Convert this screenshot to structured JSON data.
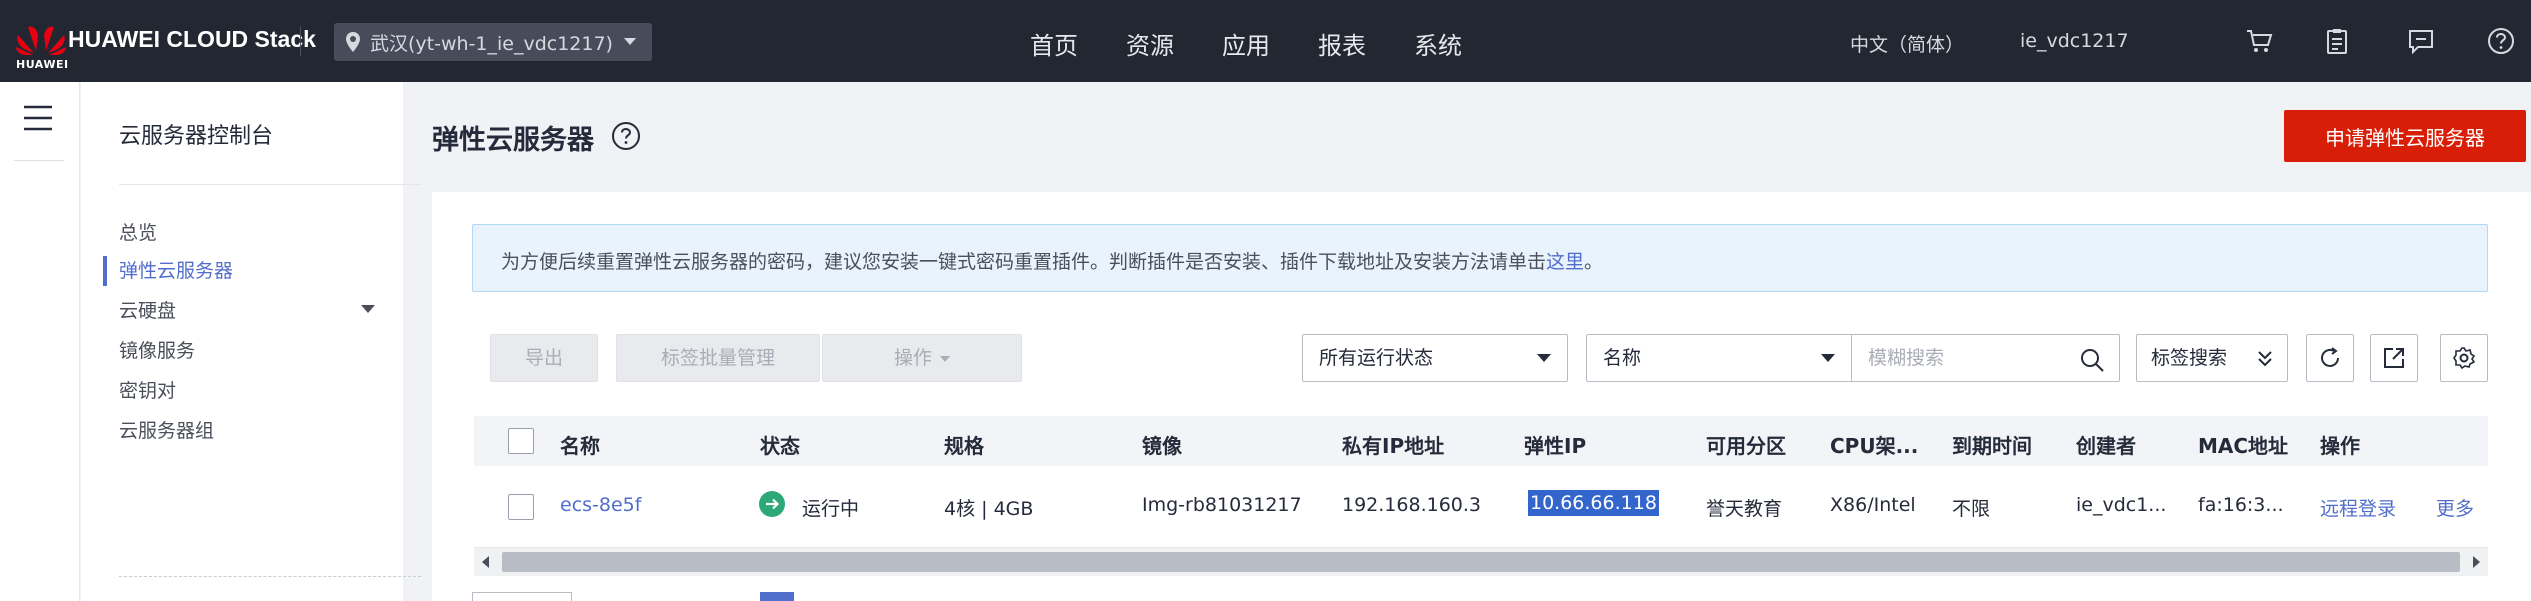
{
  "header": {
    "logo_text": "HUAWEI",
    "brand": "HUAWEI CLOUD Stack",
    "region": "武汉(yt-wh-1_ie_vdc1217)",
    "nav": [
      "首页",
      "资源",
      "应用",
      "报表",
      "系统"
    ],
    "language": "中文（简体）",
    "user": "ie_vdc1217",
    "icons": [
      "cart-icon",
      "clipboard-icon",
      "message-icon",
      "help-icon"
    ]
  },
  "sidebar": {
    "title": "云服务器控制台",
    "items": [
      {
        "label": "总览"
      },
      {
        "label": "弹性云服务器",
        "active": true
      },
      {
        "label": "云硬盘",
        "expandable": true
      },
      {
        "label": "镜像服务"
      },
      {
        "label": "密钥对"
      },
      {
        "label": "云服务器组"
      }
    ]
  },
  "main": {
    "title": "弹性云服务器",
    "apply_button": "申请弹性云服务器",
    "notice_text": "为方便后续重置弹性云服务器的密码，建议您安装一键式密码重置插件。判断插件是否安装、插件下载地址及安装方法请单击",
    "notice_link": "这里",
    "notice_end": "。",
    "toolbar": {
      "export": "导出",
      "tag_batch": "标签批量管理",
      "operations": "操作",
      "status_filter": "所有运行状态",
      "search_field": "名称",
      "search_placeholder": "模糊搜索",
      "tag_search": "标签搜索"
    },
    "table": {
      "columns": [
        "名称",
        "状态",
        "规格",
        "镜像",
        "私有IP地址",
        "弹性IP",
        "可用分区",
        "CPU架...",
        "到期时间",
        "创建者",
        "MAC地址",
        "操作"
      ],
      "rows": [
        {
          "name": "ecs-8e5f",
          "status": "运行中",
          "spec": "4核 | 4GB",
          "image": "Img-rb81031217",
          "private_ip": "192.168.160.3",
          "eip": "10.66.66.118",
          "zone": "誉天教育",
          "cpu_arch": "X86/Intel",
          "expire": "不限",
          "creator": "ie_vdc1...",
          "mac": "fa:16:3...",
          "action_login": "远程登录",
          "action_more": "更多"
        }
      ]
    }
  },
  "colors": {
    "topbar": "#232731",
    "accent": "#526ecc",
    "primary_button": "#d81e06",
    "status_ok": "#2ea878",
    "selection": "#3366cc"
  }
}
